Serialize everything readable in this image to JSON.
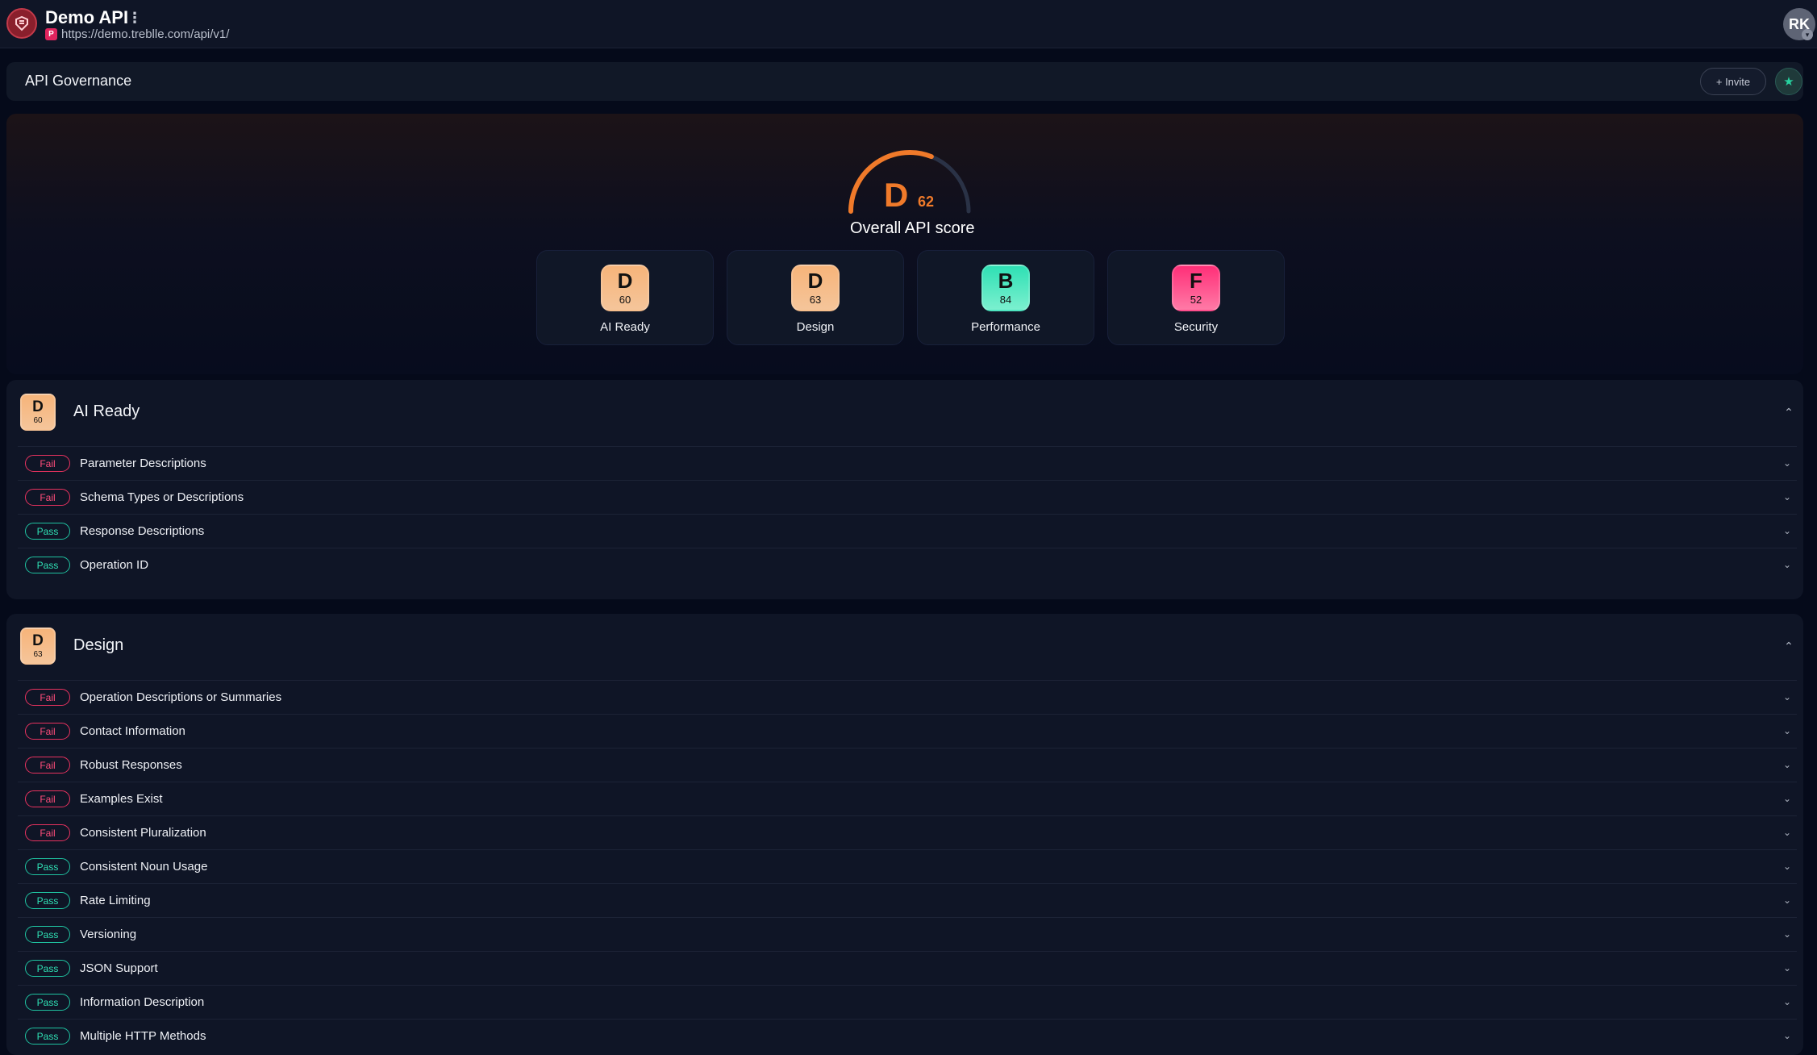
{
  "app": {
    "title": "Demo API",
    "menu_glyph": "⋮",
    "url_badge": "P",
    "url": "https://demo.treblle.com/api/v1/",
    "avatar_initials": "RK"
  },
  "governance": {
    "title": "API Governance",
    "invite_label": "+ Invite"
  },
  "overall": {
    "grade": "D",
    "score": "62",
    "label": "Overall API score",
    "score_fraction": 0.62,
    "color": "#f07a2a"
  },
  "categories": [
    {
      "grade": "D",
      "score": "60",
      "label": "AI Ready",
      "color": "orange"
    },
    {
      "grade": "D",
      "score": "63",
      "label": "Design",
      "color": "orange"
    },
    {
      "grade": "B",
      "score": "84",
      "label": "Performance",
      "color": "green"
    },
    {
      "grade": "F",
      "score": "52",
      "label": "Security",
      "color": "pink"
    }
  ],
  "sections": [
    {
      "grade": "D",
      "score": "60",
      "title": "AI Ready",
      "rules": [
        {
          "status": "Fail",
          "name": "Parameter Descriptions"
        },
        {
          "status": "Fail",
          "name": "Schema Types or Descriptions"
        },
        {
          "status": "Pass",
          "name": "Response Descriptions"
        },
        {
          "status": "Pass",
          "name": "Operation ID"
        }
      ]
    },
    {
      "grade": "D",
      "score": "63",
      "title": "Design",
      "rules": [
        {
          "status": "Fail",
          "name": "Operation Descriptions or Summaries"
        },
        {
          "status": "Fail",
          "name": "Contact Information"
        },
        {
          "status": "Fail",
          "name": "Robust Responses"
        },
        {
          "status": "Fail",
          "name": "Examples Exist"
        },
        {
          "status": "Fail",
          "name": "Consistent Pluralization"
        },
        {
          "status": "Pass",
          "name": "Consistent Noun Usage"
        },
        {
          "status": "Pass",
          "name": "Rate Limiting"
        },
        {
          "status": "Pass",
          "name": "Versioning"
        },
        {
          "status": "Pass",
          "name": "JSON Support"
        },
        {
          "status": "Pass",
          "name": "Information Description"
        },
        {
          "status": "Pass",
          "name": "Multiple HTTP Methods"
        }
      ]
    }
  ],
  "colors": {
    "fail": "#ff4d7a",
    "pass": "#2fe0b4",
    "accent": "#f07a2a"
  }
}
